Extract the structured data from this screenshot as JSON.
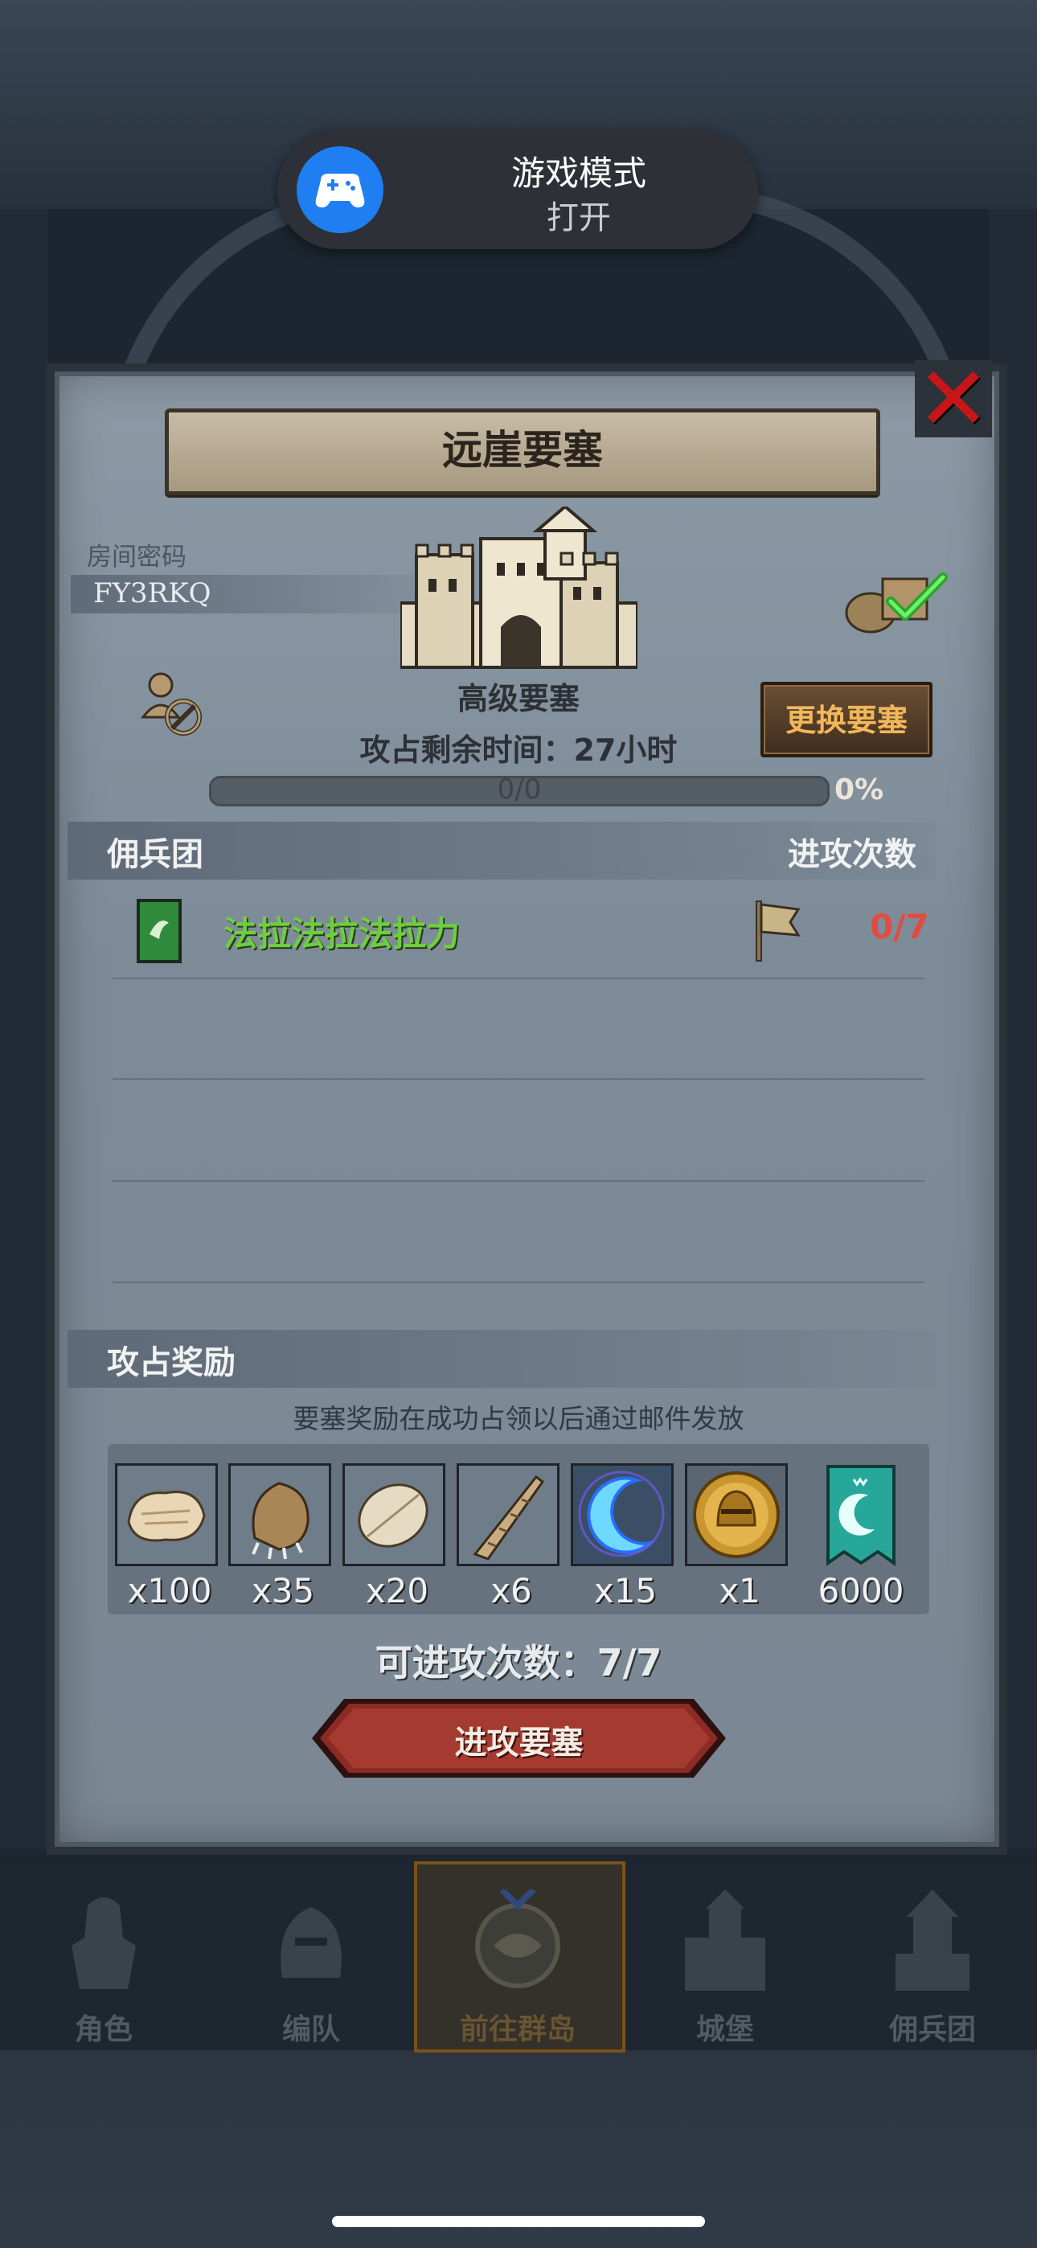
{
  "notification": {
    "title": "游戏模式",
    "status": "打开",
    "icon": "gamepad-icon",
    "icon_color": "#1f7ff2"
  },
  "dialog": {
    "title": "远崖要塞",
    "room_code_label": "房间密码",
    "room_code": "FY3RKQ",
    "fortress_level": "高级要塞",
    "capture_time": "攻占剩余时间：27小时",
    "change_button": "更换要塞",
    "progress_text": "0/0",
    "progress_percent": "0%",
    "progress_value": 0,
    "mercenary_header": "佣兵团",
    "attack_header": "进攻次数",
    "guilds": [
      {
        "name": "法拉法拉法拉力",
        "attacks": "0/7",
        "name_color": "#6ecf3e",
        "attacks_color": "#e04c42"
      }
    ],
    "reward_header": "攻占奖励",
    "reward_note": "要塞奖励在成功占领以后通过邮件发放",
    "rewards": [
      {
        "icon": "fur-pelt-icon",
        "qty": "x100"
      },
      {
        "icon": "claw-paw-icon",
        "qty": "x35"
      },
      {
        "icon": "feather-icon",
        "qty": "x20"
      },
      {
        "icon": "horn-icon",
        "qty": "x6"
      },
      {
        "icon": "crescent-moon-orb-icon",
        "qty": "x15"
      },
      {
        "icon": "golden-helmet-medal-icon",
        "qty": "x1"
      },
      {
        "icon": "guild-banner-icon",
        "qty": "6000"
      }
    ],
    "attack_count": "可进攻次数：7/7",
    "attack_button": "进攻要塞"
  },
  "bottom_nav": {
    "items": [
      {
        "label": "角色",
        "icon": "knight-icon"
      },
      {
        "label": "编队",
        "icon": "helmet-icon"
      },
      {
        "label": "前往群岛",
        "icon": "island-compass-icon",
        "active": true
      },
      {
        "label": "城堡",
        "icon": "castle-icon"
      },
      {
        "label": "佣兵团",
        "icon": "tower-icon"
      }
    ]
  }
}
